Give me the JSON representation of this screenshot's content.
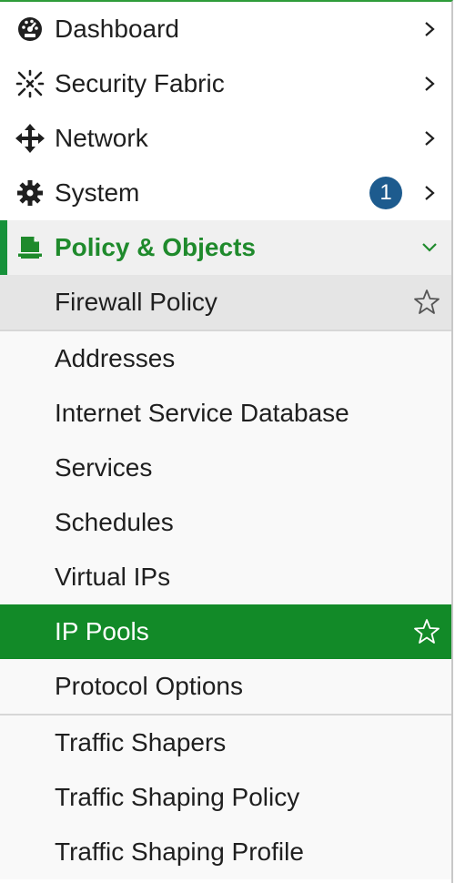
{
  "menu": {
    "top_items": [
      {
        "label": "Dashboard",
        "icon": "dashboard-icon"
      },
      {
        "label": "Security Fabric",
        "icon": "security-fabric-icon"
      },
      {
        "label": "Network",
        "icon": "network-icon"
      },
      {
        "label": "System",
        "icon": "gear-icon",
        "badge": "1"
      }
    ],
    "active_parent": {
      "label": "Policy & Objects",
      "icon": "policy-objects-icon"
    },
    "sub_items": [
      {
        "label": "Firewall Policy"
      },
      {
        "label": "Addresses"
      },
      {
        "label": "Internet Service Database"
      },
      {
        "label": "Services"
      },
      {
        "label": "Schedules"
      },
      {
        "label": "Virtual IPs"
      },
      {
        "label": "IP Pools"
      },
      {
        "label": "Protocol Options"
      },
      {
        "label": "Traffic Shapers"
      },
      {
        "label": "Traffic Shaping Policy"
      },
      {
        "label": "Traffic Shaping Profile"
      }
    ]
  },
  "colors": {
    "accent_green": "#1f8a2c",
    "selected_bg": "#128a28",
    "badge_bg": "#1d5b8e"
  }
}
